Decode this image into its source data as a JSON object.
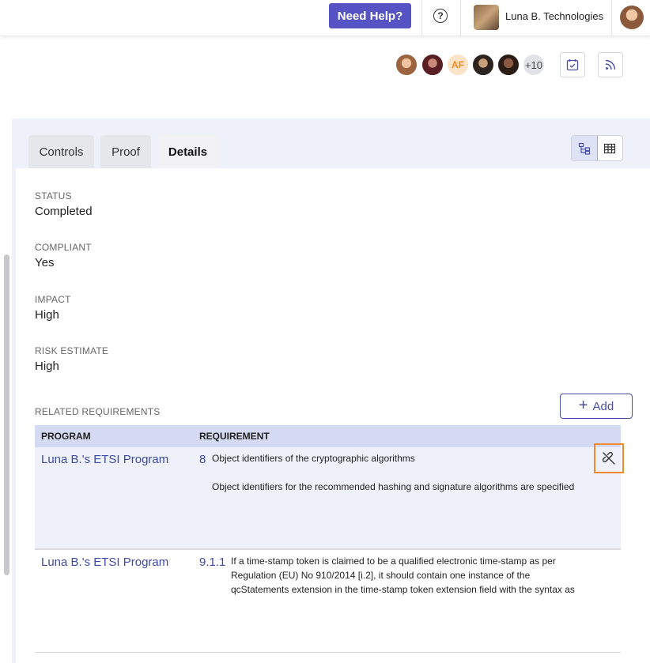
{
  "header": {
    "help_label": "Need Help?",
    "help_icon": "question-icon",
    "org_name": "Luna B. Technologies"
  },
  "collaborators": {
    "initials": "AF",
    "more_count": "+10"
  },
  "tabs": [
    {
      "label": "Controls"
    },
    {
      "label": "Proof"
    },
    {
      "label": "Details"
    }
  ],
  "fields": {
    "status_label": "STATUS",
    "status_value": "Completed",
    "compliant_label": "COMPLIANT",
    "compliant_value": "Yes",
    "impact_label": "IMPACT",
    "impact_value": "High",
    "risk_label": "RISK ESTIMATE",
    "risk_value": "High"
  },
  "related": {
    "label": "RELATED REQUIREMENTS",
    "add_label": "Add",
    "col_program": "PROGRAM",
    "col_requirement": "REQUIREMENT",
    "rows": [
      {
        "program": "Luna B.'s ETSI Program",
        "number": "8",
        "title": "Object identifiers of the cryptographic algorithms",
        "description": "Object identifiers for the recommended hashing and signature algorithms are specified"
      },
      {
        "program": "Luna B.'s ETSI Program",
        "number": "9.1.1",
        "line1": "If a time-stamp token is claimed to be a qualified electronic time-stamp as per",
        "line2": "Regulation (EU) No 910/2014 [i.2], it should contain one instance of the",
        "line3": "qcStatements extension in the time-stamp token extension field with the syntax as"
      }
    ]
  },
  "colors": {
    "accent": "#5653c4",
    "link": "#3f4aa3",
    "highlight": "#ef8a2d"
  }
}
